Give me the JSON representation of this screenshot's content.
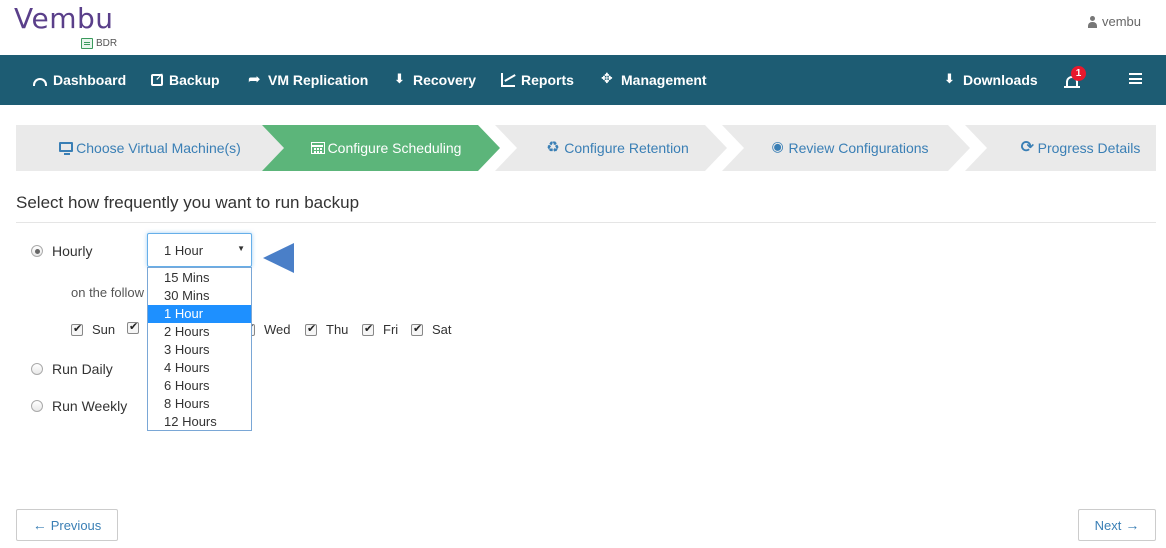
{
  "header": {
    "logo_text": "Vembu",
    "logo_sub": "BDR",
    "username": "vembu"
  },
  "nav": {
    "items": [
      {
        "label": "Dashboard",
        "icon": "dashboard-icon"
      },
      {
        "label": "Backup",
        "icon": "backup-icon"
      },
      {
        "label": "VM Replication",
        "icon": "share-icon"
      },
      {
        "label": "Recovery",
        "icon": "download-icon"
      },
      {
        "label": "Reports",
        "icon": "chart-icon"
      },
      {
        "label": "Management",
        "icon": "crosshair-icon"
      }
    ],
    "downloads_label": "Downloads",
    "notification_count": "1",
    "bar_color": "#1d5c73"
  },
  "wizard": {
    "steps": [
      {
        "label": "Choose Virtual Machine(s)",
        "icon": "monitor-icon"
      },
      {
        "label": "Configure Scheduling",
        "icon": "calendar-icon"
      },
      {
        "label": "Configure Retention",
        "icon": "recycle-icon"
      },
      {
        "label": "Review Configurations",
        "icon": "eye-icon"
      },
      {
        "label": "Progress Details",
        "icon": "refresh-icon"
      }
    ],
    "active_step": 1,
    "active_color": "#5cb57a",
    "inactive_color": "#eaeaea"
  },
  "schedule": {
    "title": "Select how frequently you want to run backup",
    "options": {
      "hourly": "Hourly",
      "daily": "Run Daily",
      "weekly": "Run Weekly"
    },
    "selected_option": "hourly",
    "interval_value": "1 Hour",
    "interval_options": [
      "15 Mins",
      "30 Mins",
      "1 Hour",
      "2 Hours",
      "3 Hours",
      "4 Hours",
      "6 Hours",
      "8 Hours",
      "12 Hours"
    ],
    "interval_selected_index": 2,
    "days_label": "on the follow",
    "days": [
      {
        "label": "Sun",
        "checked": true
      },
      {
        "label": "",
        "checked": true
      },
      {
        "label": "Wed",
        "checked": true
      },
      {
        "label": "Thu",
        "checked": true
      },
      {
        "label": "Fri",
        "checked": true
      },
      {
        "label": "Sat",
        "checked": true
      }
    ]
  },
  "footer": {
    "previous_label": "Previous",
    "next_label": "Next"
  }
}
